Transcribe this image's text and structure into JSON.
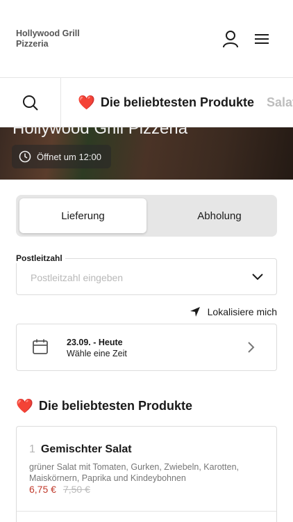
{
  "header": {
    "brand": "Hollywood Grill Pizzeria"
  },
  "categories": {
    "active_label": "Die beliebtesten Produkte",
    "next_label": "Salat"
  },
  "hero": {
    "title": "Hollywood Grill Pizzeria",
    "open_status": "Öffnet um 12:00"
  },
  "delivery_toggle": {
    "options": [
      "Lieferung",
      "Abholung"
    ],
    "selected": "Lieferung"
  },
  "postcode": {
    "label": "Postleitzahl",
    "placeholder": "Postleitzahl eingeben",
    "value": ""
  },
  "locate": {
    "label": "Lokalisiere mich"
  },
  "date_picker": {
    "date": "23.09. - Heute",
    "hint": "Wähle eine Zeit"
  },
  "section": {
    "title": "Die beliebtesten Produkte"
  },
  "products": [
    {
      "number": "1",
      "name": "Gemischter Salat",
      "description": "grüner Salat mit Tomaten, Gurken, Zwiebeln, Karotten, Maiskörnern, Paprika und Kindeybohnen",
      "price": "6,75 €",
      "old_price": "7,50 €"
    }
  ],
  "colors": {
    "heart": "#e0262d",
    "price": "#c0392b"
  }
}
